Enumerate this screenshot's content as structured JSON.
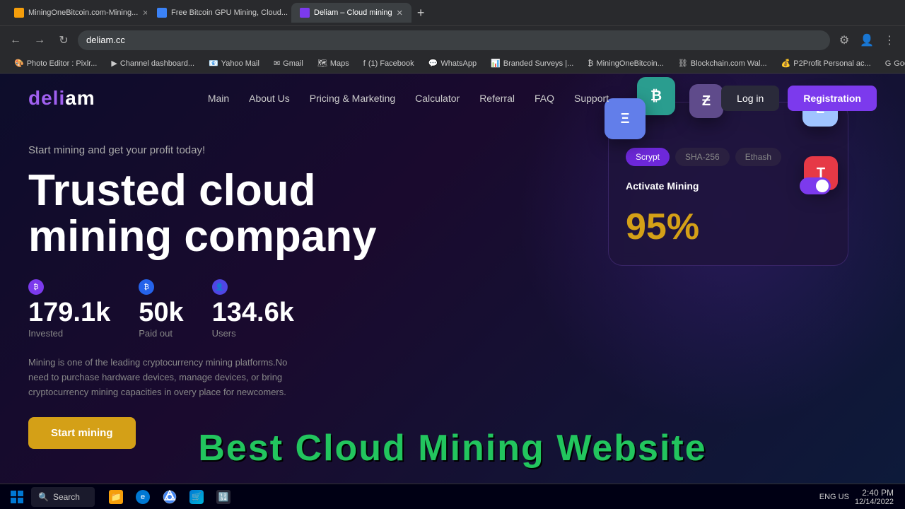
{
  "browser": {
    "tabs": [
      {
        "label": "MiningOneBitcoin.com-Mining...",
        "favicon_color": "#f59e0b",
        "active": false
      },
      {
        "label": "Free Bitcoin GPU Mining, Cloud...",
        "favicon_color": "#3b82f6",
        "active": false
      },
      {
        "label": "Deliam – Cloud mining",
        "favicon_color": "#7c3aed",
        "active": true
      }
    ],
    "address": "deliam.cc",
    "nav_back": "←",
    "nav_forward": "→",
    "nav_refresh": "↻"
  },
  "bookmarks": [
    "Photo Editor : Pixlr...",
    "Channel dashboard...",
    "Yahoo Mail",
    "Gmail",
    "Maps",
    "(1) Facebook",
    "WhatsApp",
    "Branded Surveys |...",
    "MiningOneBitcoin...",
    "Blockchain.com Wal...",
    "P2Profit Personal ac...",
    "Google AdSense"
  ],
  "site": {
    "logo": "deliam",
    "nav": {
      "links": [
        "Main",
        "About Us",
        "Pricing & Marketing",
        "Calculator",
        "Referral",
        "FAQ",
        "Support"
      ]
    },
    "buttons": {
      "login": "Log in",
      "register": "Registration"
    },
    "hero": {
      "subtitle": "Start mining and get your profit today!",
      "title": "Trusted cloud mining company",
      "desc": "Mining is one of the leading cryptocurrency mining platforms.No need to purchase hardware devices, manage devices, or bring cryptocurrency mining capacities in overy place for newcomers."
    },
    "stats": [
      {
        "value": "179.1k",
        "label": "Invested"
      },
      {
        "value": "50k",
        "label": "Paid out"
      },
      {
        "value": "134.6k",
        "label": "Users"
      }
    ],
    "cta": "Start mining",
    "card": {
      "tabs": [
        "Scrypt",
        "SHA-256",
        "Ethash"
      ],
      "activate_label": "Activate Mining",
      "percent": "95%"
    }
  },
  "overlay": {
    "text": "Best Cloud Mining Website"
  },
  "taskbar": {
    "search_label": "Search",
    "time": "2:40 PM",
    "date": "12/14/2022",
    "locale": "ENG US"
  }
}
